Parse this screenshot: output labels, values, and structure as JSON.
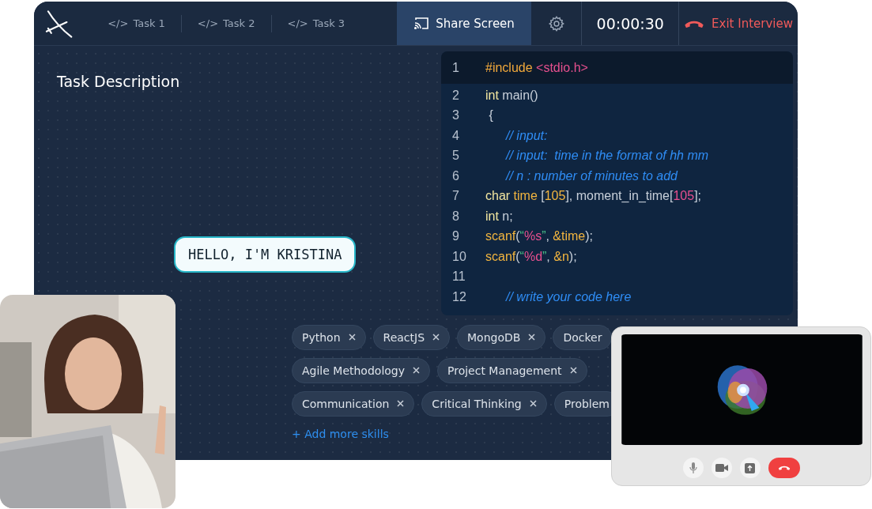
{
  "header": {
    "tasks": [
      {
        "icon": "</>",
        "label": "Task 1"
      },
      {
        "icon": "</>",
        "label": "Task 2"
      },
      {
        "icon": "</>",
        "label": "Task 3"
      }
    ],
    "share_button": "Share Screen",
    "timer": "00:00:30",
    "exit_button": "Exit Interview"
  },
  "task_description": {
    "title": "Task Description"
  },
  "caption": "HELLO, I'M KRISTINA",
  "code": [
    {
      "number": "1",
      "highlighted": true,
      "tokens": [
        {
          "text": "#include ",
          "kind": "directive"
        },
        {
          "text": "<stdio.h>",
          "kind": "string"
        }
      ]
    },
    {
      "number": "2",
      "highlighted": false,
      "tokens": [
        {
          "text": "int",
          "kind": "type"
        },
        {
          "text": " main()",
          "kind": "plain"
        }
      ]
    },
    {
      "number": "3",
      "highlighted": false,
      "tokens": [
        {
          "text": " {",
          "kind": "plain"
        }
      ]
    },
    {
      "number": "4",
      "highlighted": false,
      "tokens": [
        {
          "text": "// input:",
          "kind": "comment"
        }
      ]
    },
    {
      "number": "5",
      "highlighted": false,
      "tokens": [
        {
          "text": "// input:  time in the format of hh mm",
          "kind": "comment"
        }
      ]
    },
    {
      "number": "6",
      "highlighted": false,
      "tokens": [
        {
          "text": "// n : number of minutes to add",
          "kind": "comment"
        }
      ]
    },
    {
      "number": "7",
      "highlighted": false,
      "tokens": [
        {
          "text": "char",
          "kind": "type"
        },
        {
          "text": " time",
          "kind": "func"
        },
        {
          "text": " [",
          "kind": "plain"
        },
        {
          "text": "105",
          "kind": "func"
        },
        {
          "text": "], moment_in_time[",
          "kind": "plain"
        },
        {
          "text": "105",
          "kind": "string"
        },
        {
          "text": "];",
          "kind": "plain"
        }
      ]
    },
    {
      "number": "8",
      "highlighted": false,
      "tokens": [
        {
          "text": "int",
          "kind": "type"
        },
        {
          "text": " n;",
          "kind": "plain"
        }
      ]
    },
    {
      "number": "9",
      "highlighted": false,
      "tokens": [
        {
          "text": "scanf",
          "kind": "func"
        },
        {
          "text": "(",
          "kind": "plain"
        },
        {
          "text": "“",
          "kind": "quote"
        },
        {
          "text": "%s",
          "kind": "string"
        },
        {
          "text": "”",
          "kind": "quote"
        },
        {
          "text": ", ",
          "kind": "plain"
        },
        {
          "text": "&time",
          "kind": "func"
        },
        {
          "text": ");",
          "kind": "plain"
        }
      ]
    },
    {
      "number": "10",
      "highlighted": false,
      "tokens": [
        {
          "text": "scanf",
          "kind": "func"
        },
        {
          "text": "(",
          "kind": "plain"
        },
        {
          "text": "“",
          "kind": "quote"
        },
        {
          "text": "%d",
          "kind": "string"
        },
        {
          "text": "”",
          "kind": "quote"
        },
        {
          "text": ", ",
          "kind": "plain"
        },
        {
          "text": "&n",
          "kind": "func"
        },
        {
          "text": ");",
          "kind": "plain"
        }
      ]
    },
    {
      "number": "11",
      "highlighted": false
    },
    {
      "number": "12",
      "highlighted": false,
      "tokens": [
        {
          "text": "// write your code here",
          "kind": "comment"
        }
      ]
    }
  ],
  "skills": [
    [
      {
        "label": "Python",
        "removable": true
      },
      {
        "label": "ReactJS",
        "removable": true
      },
      {
        "label": "MongoDB",
        "removable": true
      },
      {
        "label": "Docker",
        "removable": false
      }
    ],
    [
      {
        "label": "Agile Methodology",
        "removable": true
      },
      {
        "label": "Project Management",
        "removable": true
      }
    ],
    [
      {
        "label": "Communication",
        "removable": true
      },
      {
        "label": "Critical Thinking",
        "removable": true
      },
      {
        "label": "Problem",
        "removable": false
      }
    ]
  ],
  "add_skills_link": "+ Add more skills",
  "video_call": {
    "kind": "picture"
  },
  "photo": {
    "kind": "picture"
  }
}
